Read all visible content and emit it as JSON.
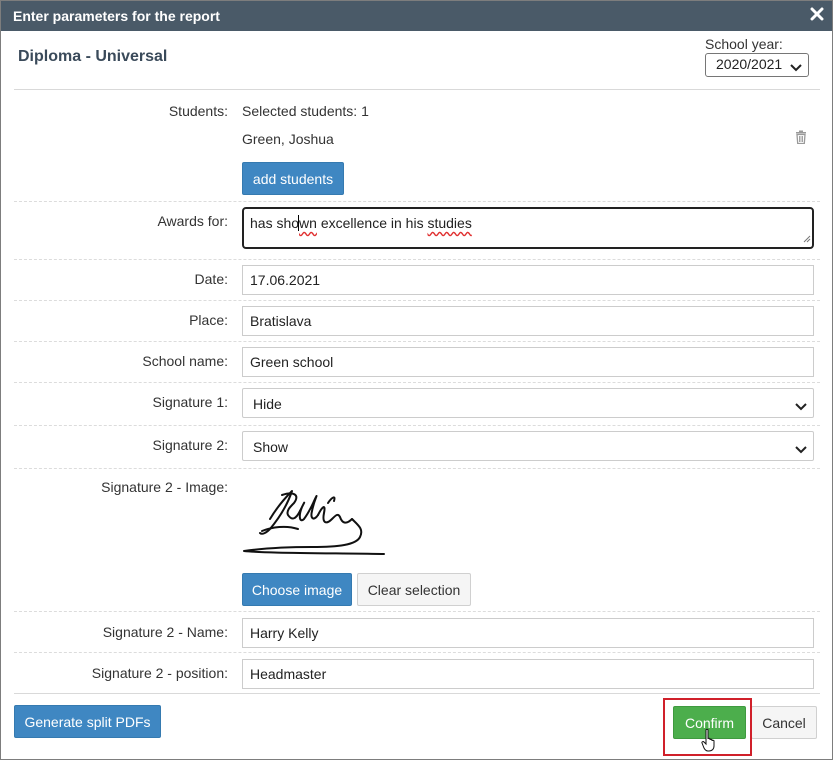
{
  "dialog": {
    "title": "Enter parameters for the report"
  },
  "report": {
    "name": "Diploma - Universal"
  },
  "school_year": {
    "label": "School year:",
    "selected": "2020/2021"
  },
  "students": {
    "label": "Students:",
    "selected_text": "Selected students: 1",
    "items": [
      "Green, Joshua"
    ],
    "add_button": "add students"
  },
  "awards": {
    "label": "Awards for:",
    "value_part1": "has sho",
    "value_part2": "wn",
    "value_part3": " excellence in his ",
    "value_part4": "studies"
  },
  "date": {
    "label": "Date:",
    "value": "17.06.2021"
  },
  "place": {
    "label": "Place:",
    "value": "Bratislava"
  },
  "school_name": {
    "label": "School name:",
    "value": "Green school"
  },
  "signature1": {
    "label": "Signature 1:",
    "selected": "Hide"
  },
  "signature2": {
    "label": "Signature 2:",
    "selected": "Show"
  },
  "signature2_image": {
    "label": "Signature 2 - Image:",
    "choose_button": "Choose image",
    "clear_button": "Clear selection"
  },
  "signature2_name": {
    "label": "Signature 2 - Name:",
    "value": "Harry Kelly"
  },
  "signature2_position": {
    "label": "Signature 2 - position:",
    "value": "Headmaster"
  },
  "footer": {
    "generate_button": "Generate split PDFs",
    "confirm_button": "Confirm",
    "cancel_button": "Cancel"
  },
  "colors": {
    "titlebar": "#4a5a68",
    "primary": "#3f87c2",
    "confirm": "#4cae4c",
    "highlight": "#d0202a"
  }
}
